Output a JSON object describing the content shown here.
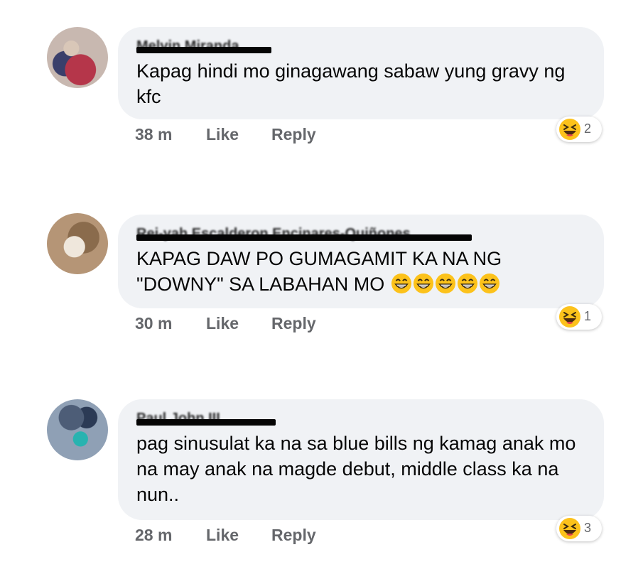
{
  "comments": [
    {
      "author": "Melvin Miranda",
      "text": "Kapag hindi mo ginagawang sabaw yung gravy ng kfc",
      "time": "38 m",
      "like_label": "Like",
      "reply_label": "Reply",
      "reaction_icon": "laughing-emoji-icon",
      "reaction_count": "2"
    },
    {
      "author": "Rei-yah Escalderon Encinares-Quiñones",
      "text": "KAPAG DAW PO GUMAGAMIT KA NA NG \"DOWNY\" SA LABAHAN MO",
      "text_emoji": "grinning-face-emoji-icon",
      "text_emoji_count": 5,
      "time": "30 m",
      "like_label": "Like",
      "reply_label": "Reply",
      "reaction_icon": "laughing-emoji-icon",
      "reaction_count": "1"
    },
    {
      "author": "Paul John III",
      "text": "pag sinusulat ka na sa blue bills ng kamag anak mo na may anak na magde debut, middle class ka na nun..",
      "time": "28 m",
      "like_label": "Like",
      "reply_label": "Reply",
      "reaction_icon": "laughing-emoji-icon",
      "reaction_count": "3"
    }
  ],
  "colors": {
    "bubble": "#f0f2f5",
    "meta_text": "#65676b",
    "body_text": "#050505",
    "emoji_yellow": "#fcc21b"
  }
}
